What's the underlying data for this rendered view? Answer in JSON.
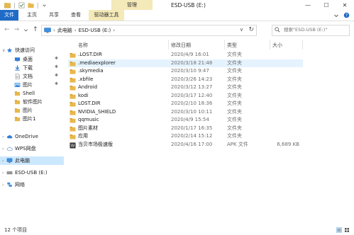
{
  "window": {
    "title": "ESD-USB (E:)",
    "context_tab_top": "管理",
    "controls": [
      "—",
      "☐",
      "✕"
    ]
  },
  "ribbon": {
    "file": "文件",
    "tabs": [
      "主页",
      "共享",
      "查看"
    ],
    "context_tab": "驱动器工具"
  },
  "address": {
    "crumbs": [
      "此电脑",
      "ESD-USB (E:)"
    ],
    "search_placeholder": "搜索\"ESD-USB (E:)\""
  },
  "sidebar": {
    "items": [
      {
        "label": "快速访问",
        "icon": "star-icon",
        "color": "#2f7ed8",
        "pinned": false
      },
      {
        "label": "桌面",
        "icon": "desktop-icon",
        "color": "#2f7ed8",
        "pinned": true
      },
      {
        "label": "下载",
        "icon": "download-icon",
        "color": "#2f7ed8",
        "pinned": true
      },
      {
        "label": "文档",
        "icon": "document-icon",
        "color": "#7a7a7a",
        "pinned": true
      },
      {
        "label": "图片",
        "icon": "pictures-icon",
        "color": "#2f7ed8",
        "pinned": true
      },
      {
        "label": "Shell",
        "icon": "folder-icon",
        "color": "#e8b84b",
        "pinned": false
      },
      {
        "label": "软件图片",
        "icon": "folder-icon",
        "color": "#e8b84b",
        "pinned": false
      },
      {
        "label": "图片",
        "icon": "folder-icon",
        "color": "#e8b84b",
        "pinned": false
      },
      {
        "label": "图片1",
        "icon": "folder-icon",
        "color": "#e8b84b",
        "pinned": false
      },
      {
        "label": "OneDrive",
        "icon": "cloud-icon",
        "color": "#2f7ed8",
        "pinned": false
      },
      {
        "label": "WPS网盘",
        "icon": "cloud-icon",
        "color": "#6b8fd6",
        "pinned": false
      },
      {
        "label": "此电脑",
        "icon": "computer-icon",
        "color": "#2f7ed8",
        "pinned": false,
        "selected": true
      },
      {
        "label": "ESD-USB (E:)",
        "icon": "drive-icon",
        "color": "#7a7a7a",
        "pinned": false
      },
      {
        "label": "网络",
        "icon": "network-icon",
        "color": "#2f7ed8",
        "pinned": false
      }
    ]
  },
  "columns": {
    "name": "名称",
    "date": "修改日期",
    "type": "类型",
    "size": "大小"
  },
  "files": [
    {
      "name": ".LOST.DIR",
      "date": "2020/4/9 16:01",
      "type": "文件夹",
      "size": "",
      "icon": "folder-icon"
    },
    {
      "name": ".mediaexplorer",
      "date": "2020/3/18 21:48",
      "type": "文件夹",
      "size": "",
      "icon": "folder-icon",
      "highlight": true
    },
    {
      "name": ".skymedia",
      "date": "2020/3/10 9:47",
      "type": "文件夹",
      "size": "",
      "icon": "folder-icon"
    },
    {
      "name": ".xbfile",
      "date": "2020/3/26 14:23",
      "type": "文件夹",
      "size": "",
      "icon": "folder-icon"
    },
    {
      "name": "Android",
      "date": "2020/3/12 13:27",
      "type": "文件夹",
      "size": "",
      "icon": "folder-icon"
    },
    {
      "name": "kodi",
      "date": "2020/3/17 12:40",
      "type": "文件夹",
      "size": "",
      "icon": "folder-icon"
    },
    {
      "name": "LOST.DIR",
      "date": "2020/2/10 18:36",
      "type": "文件夹",
      "size": "",
      "icon": "folder-icon"
    },
    {
      "name": "NVIDIA_SHIELD",
      "date": "2020/3/10 10:11",
      "type": "文件夹",
      "size": "",
      "icon": "folder-icon"
    },
    {
      "name": "qqmusic",
      "date": "2020/4/9 15:54",
      "type": "文件夹",
      "size": "",
      "icon": "folder-icon"
    },
    {
      "name": "图片素材",
      "date": "2020/1/17 16:35",
      "type": "文件夹",
      "size": "",
      "icon": "folder-icon"
    },
    {
      "name": "应用",
      "date": "2020/2/14 15:12",
      "type": "文件夹",
      "size": "",
      "icon": "folder-icon"
    },
    {
      "name": "当贝市场极速版",
      "date": "2020/4/16 17:00",
      "type": "APK 文件",
      "size": "6,689 KB",
      "icon": "apk-file-icon"
    }
  ],
  "status": {
    "count": "12 个项目"
  },
  "colors": {
    "accent": "#1f6bc7",
    "context_tab": "#f4e9b8",
    "selected": "#cce8ff",
    "hover_row": "#e5f3ff",
    "folder": "#e8b84b"
  }
}
